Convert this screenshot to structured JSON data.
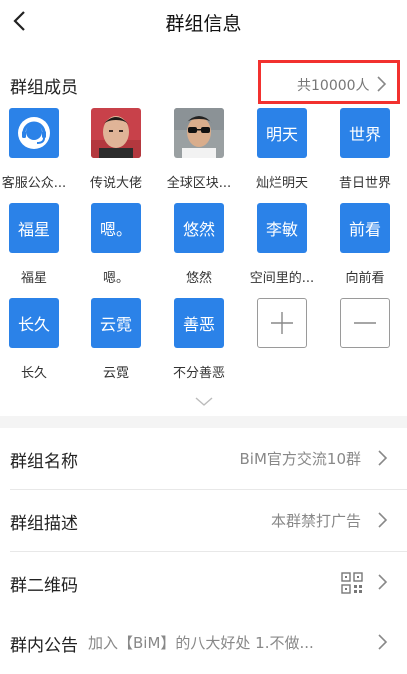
{
  "nav": {
    "title": "群组信息",
    "back_icon": "chevron-left-icon"
  },
  "members": {
    "section_label": "群组成员",
    "count_text": "共10000人",
    "highlight_color": "#f2312f",
    "items": [
      {
        "tile": "",
        "name": "客服公众...",
        "kind": "service-avatar"
      },
      {
        "tile": "",
        "name": "传说大佬",
        "kind": "photo"
      },
      {
        "tile": "",
        "name": "全球区块...",
        "kind": "photo"
      },
      {
        "tile": "明天",
        "name": "灿烂明天",
        "kind": "text"
      },
      {
        "tile": "世界",
        "name": "昔日世界",
        "kind": "text"
      },
      {
        "tile": "福星",
        "name": "福星",
        "kind": "text"
      },
      {
        "tile": "嗯。",
        "name": "嗯。",
        "kind": "text"
      },
      {
        "tile": "悠然",
        "name": "悠然",
        "kind": "text"
      },
      {
        "tile": "李敏",
        "name": "空间里的...",
        "kind": "text"
      },
      {
        "tile": "前看",
        "name": "向前看",
        "kind": "text"
      },
      {
        "tile": "长久",
        "name": "长久",
        "kind": "text"
      },
      {
        "tile": "云霓",
        "name": "云霓",
        "kind": "text"
      },
      {
        "tile": "善恶",
        "name": "不分善恶",
        "kind": "text"
      }
    ],
    "add_icon": "plus-icon",
    "remove_icon": "minus-icon",
    "expand_icon": "chevron-down-icon",
    "tile_color": "#2b82e8"
  },
  "settings": {
    "group_name": {
      "label": "群组名称",
      "value": "BiM官方交流10群"
    },
    "group_desc": {
      "label": "群组描述",
      "value": "本群禁打广告"
    },
    "group_qr": {
      "label": "群二维码",
      "icon": "qr-code-icon"
    },
    "group_notice": {
      "label": "群内公告",
      "value": "加入【BiM】的八大好处 1.不做..."
    }
  }
}
